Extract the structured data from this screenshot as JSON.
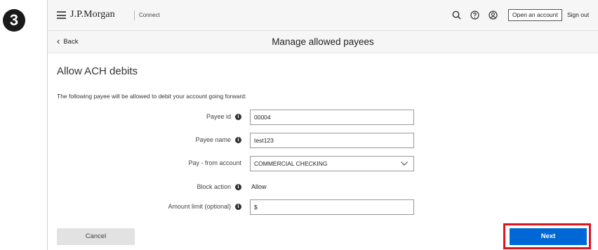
{
  "step": {
    "number": "3"
  },
  "header": {
    "brand": "J.P.Morgan",
    "product": "Connect",
    "open_account_label": "Open an account",
    "sign_out_label": "Sign out"
  },
  "subheader": {
    "back_label": "Back",
    "title": "Manage allowed payees"
  },
  "main": {
    "section_title": "Allow ACH debits",
    "intro": "The following payee will be allowed to debit your account going forward:",
    "fields": {
      "payee_id": {
        "label": "Payee id",
        "value": "00004"
      },
      "payee_name": {
        "label": "Payee name",
        "value": "test123"
      },
      "pay_from": {
        "label": "Pay - from account",
        "value": "COMMERCIAL CHECKING"
      },
      "block_action": {
        "label": "Block action",
        "value": "Allow"
      },
      "amount_limit": {
        "label": "Amount limit (optional)",
        "value": "$"
      }
    }
  },
  "footer": {
    "cancel_label": "Cancel",
    "next_label": "Next"
  },
  "colors": {
    "primary": "#0068d6",
    "highlight": "#e0141e"
  },
  "icons": [
    "menu-icon",
    "search-icon",
    "help-icon",
    "user-icon",
    "chevron-left-icon",
    "info-icon",
    "chevron-down-icon"
  ]
}
